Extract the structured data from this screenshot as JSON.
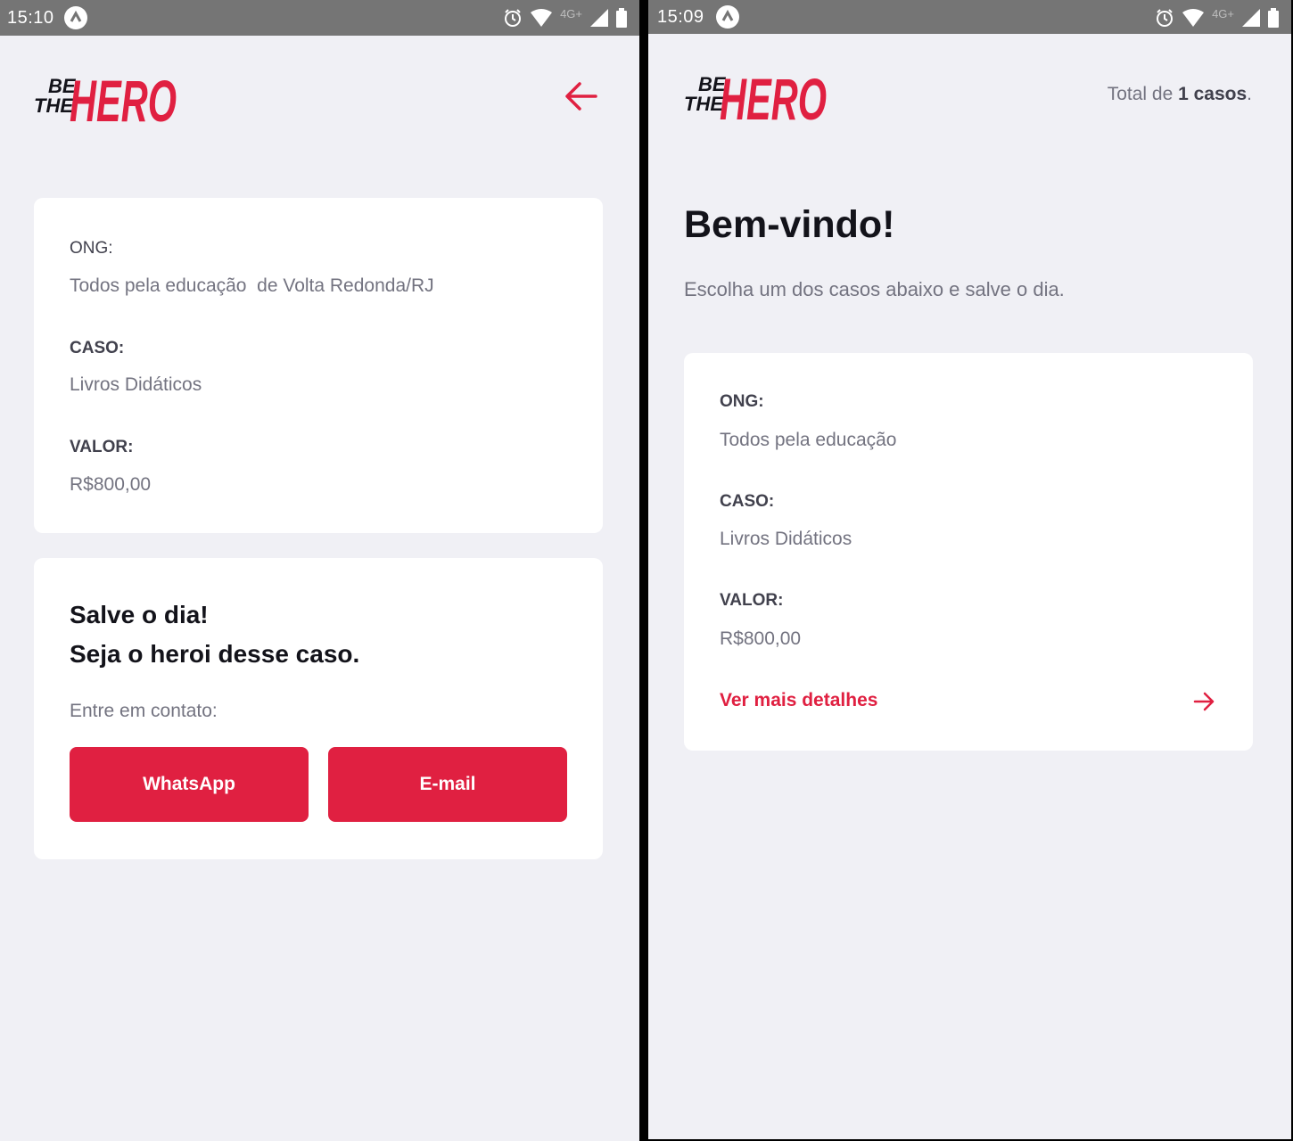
{
  "brand": {
    "accent": "#e02041",
    "text_dark": "#13131a",
    "text_label": "#41414d",
    "text_muted": "#737380",
    "background": "#f0f0f5"
  },
  "logo": {
    "line1": "BE",
    "line2": "THE",
    "line3": "HERO"
  },
  "detail_screen": {
    "status": {
      "time": "15:10",
      "network": "4G+"
    },
    "case": {
      "ong_label": "ONG:",
      "ong_value": "Todos pela educação  de Volta Redonda/RJ",
      "case_label": "CASO:",
      "case_value": "Livros Didáticos",
      "value_label": "VALOR:",
      "value_value": "R$800,00"
    },
    "contact": {
      "title_line1": "Salve o dia!",
      "title_line2": "Seja o heroi desse caso.",
      "prompt": "Entre em contato:",
      "whatsapp_label": "WhatsApp",
      "email_label": "E-mail"
    }
  },
  "list_screen": {
    "status": {
      "time": "15:09",
      "network": "4G+"
    },
    "header": {
      "total_prefix": "Total de ",
      "total_count": "1 casos",
      "total_suffix": "."
    },
    "title": "Bem-vindo!",
    "subtitle": "Escolha um dos casos abaixo e salve o dia.",
    "case": {
      "ong_label": "ONG:",
      "ong_value": "Todos pela educação",
      "case_label": "CASO:",
      "case_value": "Livros Didáticos",
      "value_label": "VALOR:",
      "value_value": "R$800,00",
      "details_link": "Ver mais detalhes"
    }
  }
}
